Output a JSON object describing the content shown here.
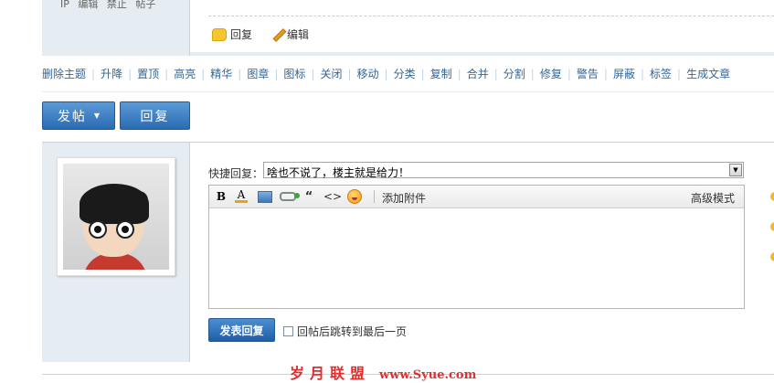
{
  "top_post": {
    "meta": [
      "IP",
      "编辑",
      "禁止",
      "帖子"
    ],
    "actions": {
      "reply": "回复",
      "edit": "编辑"
    }
  },
  "moderation": [
    "删除主题",
    "升降",
    "置顶",
    "高亮",
    "精华",
    "图章",
    "图标",
    "关闭",
    "移动",
    "分类",
    "复制",
    "合并",
    "分割",
    "修复",
    "警告",
    "屏蔽",
    "标签",
    "生成文章"
  ],
  "buttons": {
    "post": "发帖",
    "reply": "回复"
  },
  "quick_reply": {
    "label": "快捷回复：",
    "selected": "啥也不说了，楼主就是给力！"
  },
  "editor": {
    "attach": "添加附件",
    "advanced": "高级模式",
    "content": ""
  },
  "submit": {
    "label": "发表回复",
    "jump_label": "回帖后跳转到最后一页"
  },
  "watermark": {
    "text": "岁月联盟",
    "url": "www.Syue.com"
  }
}
